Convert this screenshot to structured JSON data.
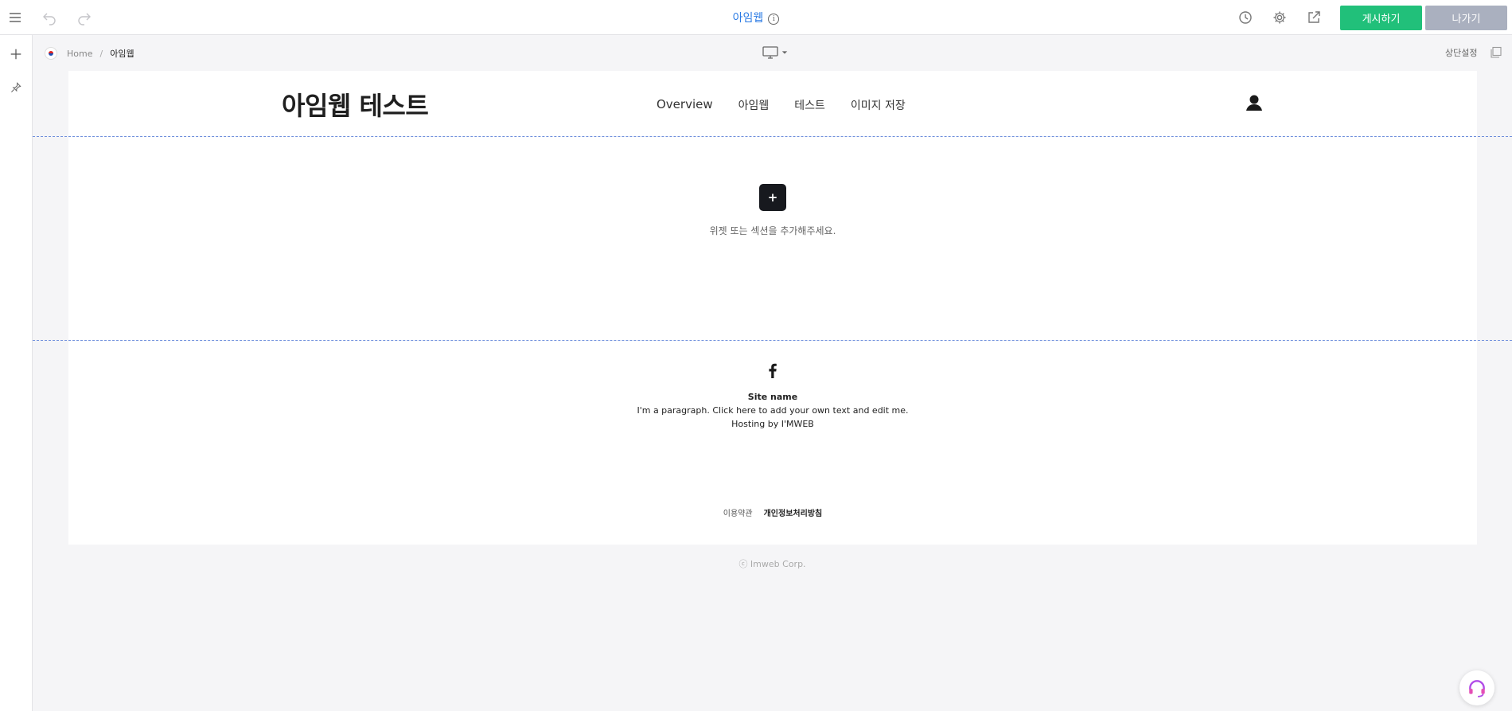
{
  "toolbar": {
    "site_title": "아임웹",
    "publish_label": "게시하기",
    "exit_label": "나가기"
  },
  "canvas_bar": {
    "breadcrumb_home": "Home",
    "breadcrumb_sep": "/",
    "breadcrumb_current": "아임웹",
    "top_setting_label": "상단설정"
  },
  "site": {
    "logo": "아임웹 테스트",
    "nav": [
      "Overview",
      "아임웹",
      "테스트",
      "이미지 저장"
    ]
  },
  "section": {
    "add_symbol": "+",
    "add_hint": "위젯 또는 섹션을 추가해주세요."
  },
  "footer": {
    "site_name": "Site name",
    "paragraph": "I'm a paragraph. Click here to add your own text and edit me.",
    "hosting": "Hosting by I'MWEB",
    "terms_label": "이용약관",
    "privacy_label": "개인정보처리방침",
    "copyright": "ⓒ Imweb Corp."
  },
  "colors": {
    "accent": "#2b7be4",
    "publish": "#21c07a",
    "exit": "#aab0bf",
    "guide": "#6f8fdc"
  }
}
